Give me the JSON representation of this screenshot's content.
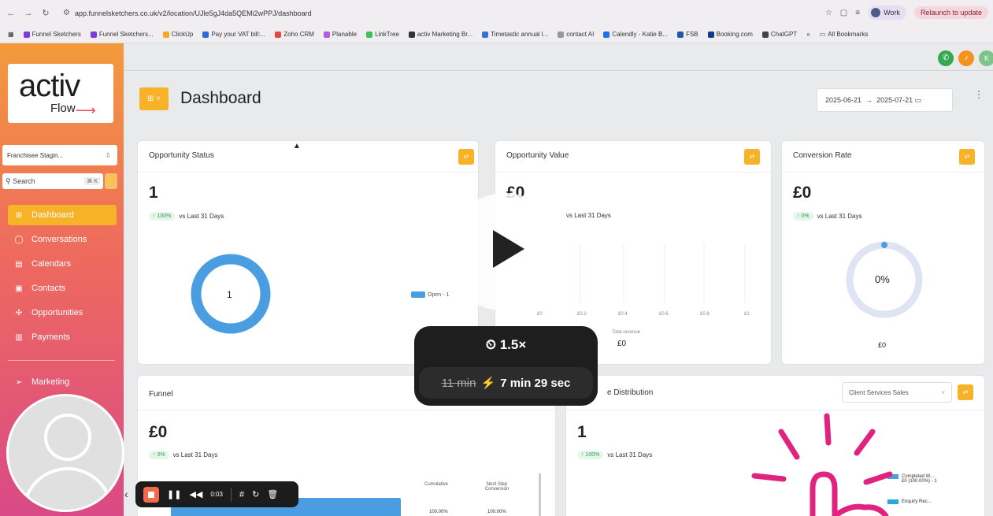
{
  "browser": {
    "url": "app.funnelsketchers.co.uk/v2/location/UJle5gJ4da5QEMi2wPPJ/dashboard",
    "profile": "Work",
    "relaunch": "Relaunch to update",
    "bookmarks": [
      "Funnel Sketchers",
      "Funnel Sketchers...",
      "ClickUp",
      "Pay your VAT bill:...",
      "Zoho CRM",
      "Planable",
      "LinkTree",
      "activ Marketing Br...",
      "Timetastic annual l...",
      "contact AI",
      "Calendly - Katie B...",
      "FSB",
      "Booking.com",
      "ChatGPT",
      "»",
      "All Bookmarks"
    ]
  },
  "sidebar": {
    "logo_main": "activ",
    "logo_sub": "Flow",
    "location": "Franchisee Stagin...",
    "search_placeholder": "Search",
    "search_kbd": "⌘ K",
    "items": [
      {
        "label": "Dashboard",
        "icon": "⊞"
      },
      {
        "label": "Conversations",
        "icon": "◯"
      },
      {
        "label": "Calendars",
        "icon": "▤"
      },
      {
        "label": "Contacts",
        "icon": "▣"
      },
      {
        "label": "Opportunities",
        "icon": "✣"
      },
      {
        "label": "Payments",
        "icon": "▥"
      },
      {
        "label": "Marketing",
        "icon": "➢"
      }
    ]
  },
  "header": {
    "title": "Dashboard",
    "date_from": "2025-06-21",
    "date_arrow": "→",
    "date_to": "2025-07-21"
  },
  "cards": {
    "status": {
      "title": "Opportunity Status",
      "value": "1",
      "pct": "↑ 100%",
      "vs": "vs Last 31 Days",
      "donut_label": "1",
      "legend": "Open - 1"
    },
    "value": {
      "title": "Opportunity Value",
      "value": "£0",
      "vs": "vs Last 31 Days",
      "ticks": [
        "£0",
        "£0.2",
        "£0.4",
        "£0.6",
        "£0.8",
        "£1"
      ],
      "xlabel": "Total revenue",
      "total": "£0"
    },
    "conversion": {
      "title": "Conversion Rate",
      "value": "£0",
      "pct": "↑ 0%",
      "vs": "vs Last 31 Days",
      "center": "0%",
      "bottom": "£0"
    },
    "funnel": {
      "title": "Funnel",
      "value": "£0",
      "pct": "↑ 0%",
      "vs": "vs Last 31 Days",
      "col1": "Cumulative",
      "col2": "Next Step Conversion",
      "row1a": "100.00%",
      "row1b": "100.00%"
    },
    "distribution": {
      "title": "Stage Distribution",
      "title_visible": "e Distribution",
      "select": "Client Services Sales",
      "value": "1",
      "pct": "↑ 100%",
      "vs": "vs Last 31 Days",
      "legend1": "Completed W...",
      "legend1b": "£0 (100.00%) - 1",
      "legend2": "Enquiry Rec..."
    }
  },
  "overlay": {
    "speed": "1.5×",
    "old_time": "11 min",
    "new_time": "7 min 29 sec",
    "rec_time": "0:03"
  },
  "colors": {
    "accent": "#f7b227",
    "donut": "#4a9de0",
    "rec": "#f26a4b"
  }
}
